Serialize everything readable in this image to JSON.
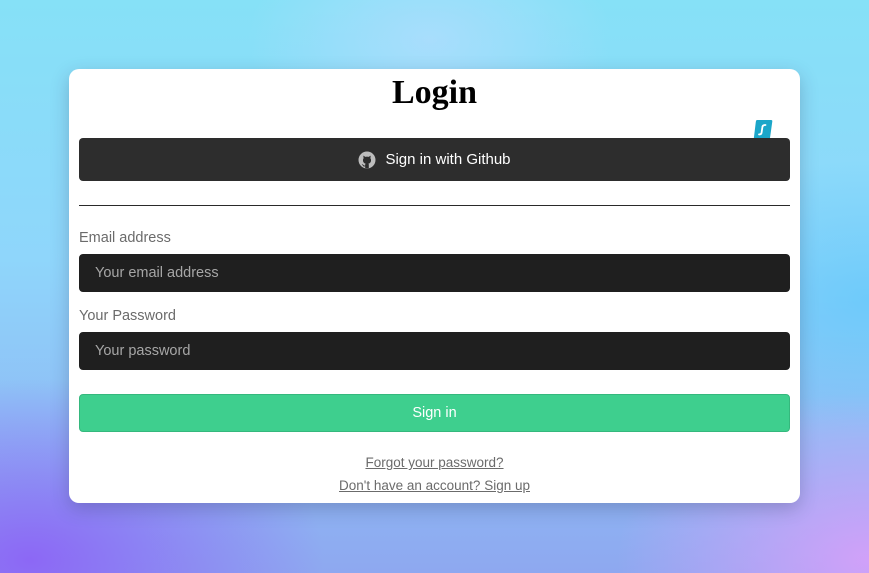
{
  "login": {
    "title": "Login",
    "github_button_label": "Sign in with Github",
    "email_label": "Email address",
    "email_placeholder": "Your email address",
    "email_value": "",
    "password_label": "Your Password",
    "password_placeholder": "Your password",
    "password_value": "",
    "submit_label": "Sign in",
    "forgot_password_link": "Forgot your password?",
    "signup_link": "Don't have an account? Sign up"
  },
  "icons": {
    "github": "github-icon",
    "extension": "surfshark-extension-icon"
  },
  "colors": {
    "primary_button": "#3ecf8e",
    "github_button": "#2d2d2d",
    "input_background": "#1f1f1f",
    "card_background": "#ffffff",
    "muted_text": "#6b6b6b"
  }
}
